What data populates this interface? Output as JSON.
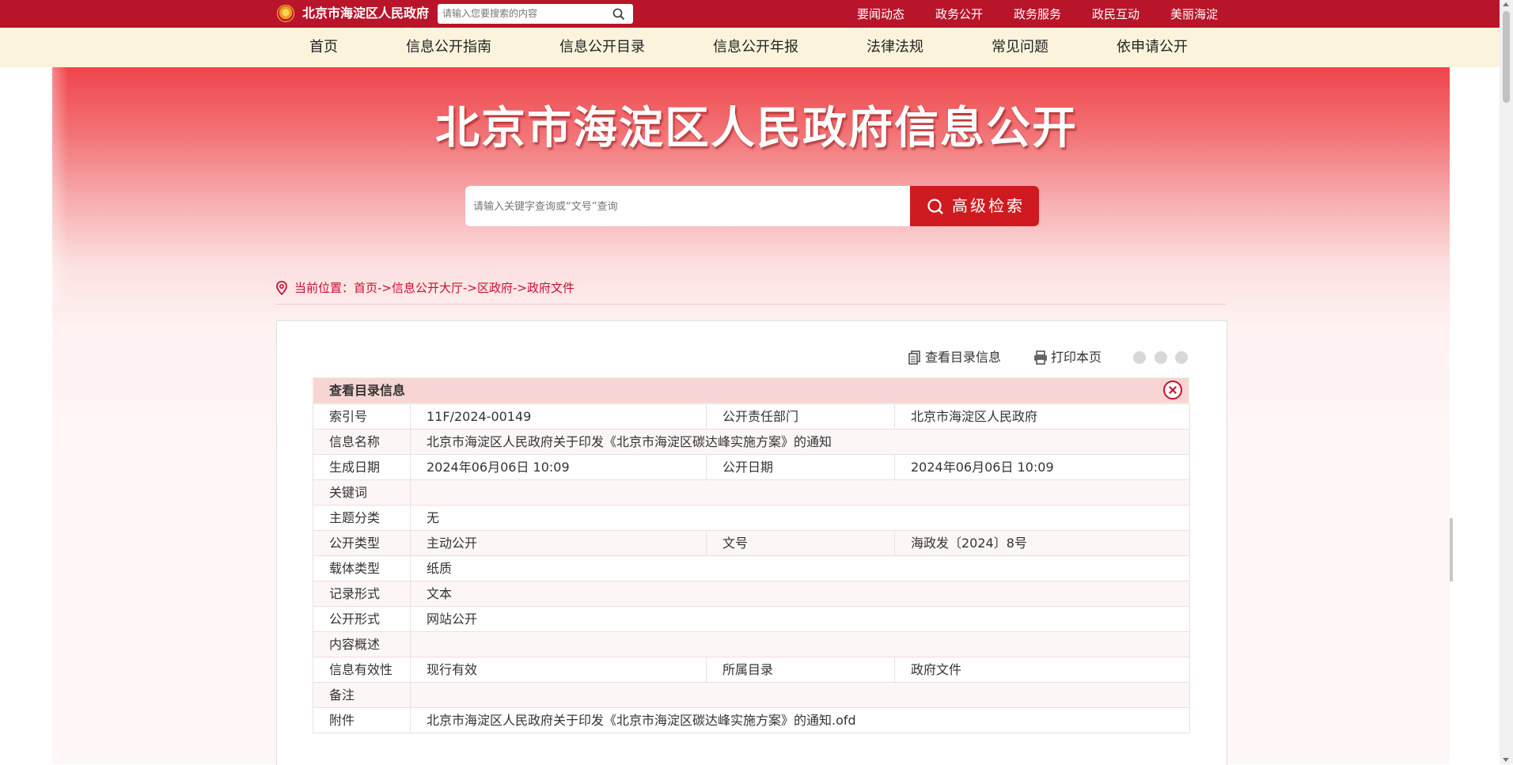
{
  "topbar": {
    "site_title": "北京市海淀区人民政府",
    "search_placeholder": "请输入您要搜索的内容",
    "links": [
      "要闻动态",
      "政务公开",
      "政务服务",
      "政民互动",
      "美丽海淀"
    ]
  },
  "nav": {
    "items": [
      "首页",
      "信息公开指南",
      "信息公开目录",
      "信息公开年报",
      "法律法规",
      "常见问题",
      "依申请公开"
    ]
  },
  "banner": {
    "title": "北京市海淀区人民政府信息公开",
    "search_placeholder": "请输入关键字查询或“文号”查询",
    "search_button": "高级检索"
  },
  "breadcrumb": {
    "text": "当前位置：首页->信息公开大厅->区政府->政府文件"
  },
  "tools": {
    "catalog_info": "查看目录信息",
    "print": "打印本页"
  },
  "info": {
    "header": "查看目录信息",
    "rows": {
      "index_no_label": "索引号",
      "index_no": "11F/2024-00149",
      "dept_label": "公开责任部门",
      "dept": "北京市海淀区人民政府",
      "name_label": "信息名称",
      "name": "北京市海淀区人民政府关于印发《北京市海淀区碳达峰实施方案》的通知",
      "created_label": "生成日期",
      "created": "2024年06月06日 10:09",
      "published_label": "公开日期",
      "published": "2024年06月06日 10:09",
      "keywords_label": "关键词",
      "keywords": "",
      "topic_label": "主题分类",
      "topic": "无",
      "open_type_label": "公开类型",
      "open_type": "主动公开",
      "doc_no_label": "文号",
      "doc_no": "海政发〔2024〕8号",
      "carrier_label": "载体类型",
      "carrier": "纸质",
      "record_label": "记录形式",
      "record": "文本",
      "form_label": "公开形式",
      "form": "网站公开",
      "summary_label": "内容概述",
      "summary": "",
      "validity_label": "信息有效性",
      "validity": "现行有效",
      "catalog_label": "所属目录",
      "catalog": "政府文件",
      "remark_label": "备注",
      "remark": "",
      "attachment_label": "附件",
      "attachment": "北京市海淀区人民政府关于印发《北京市海淀区碳达峰实施方案》的通知.ofd"
    }
  },
  "colors": {
    "brand_red": "#b8152a",
    "button_red": "#cf1a1f",
    "nav_bg": "#fbf3dc",
    "table_header_bg": "#f8d5d5"
  }
}
